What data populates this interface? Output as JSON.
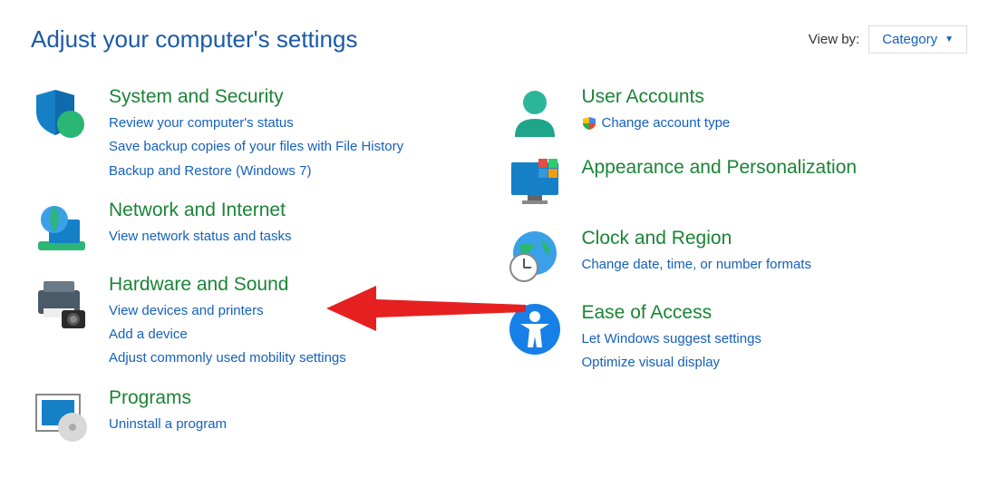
{
  "header": {
    "title": "Adjust your computer's settings",
    "viewby_label": "View by:",
    "viewby_value": "Category"
  },
  "left": [
    {
      "title": "System and Security",
      "subs": [
        "Review your computer's status",
        "Save backup copies of your files with File History",
        "Backup and Restore (Windows 7)"
      ]
    },
    {
      "title": "Network and Internet",
      "subs": [
        "View network status and tasks"
      ]
    },
    {
      "title": "Hardware and Sound",
      "subs": [
        "View devices and printers",
        "Add a device",
        "Adjust commonly used mobility settings"
      ]
    },
    {
      "title": "Programs",
      "subs": [
        "Uninstall a program"
      ]
    }
  ],
  "right": [
    {
      "title": "User Accounts",
      "subs": [
        "Change account type"
      ],
      "shield": true
    },
    {
      "title": "Appearance and Personalization",
      "subs": []
    },
    {
      "title": "Clock and Region",
      "subs": [
        "Change date, time, or number formats"
      ]
    },
    {
      "title": "Ease of Access",
      "subs": [
        "Let Windows suggest settings",
        "Optimize visual display"
      ]
    }
  ]
}
